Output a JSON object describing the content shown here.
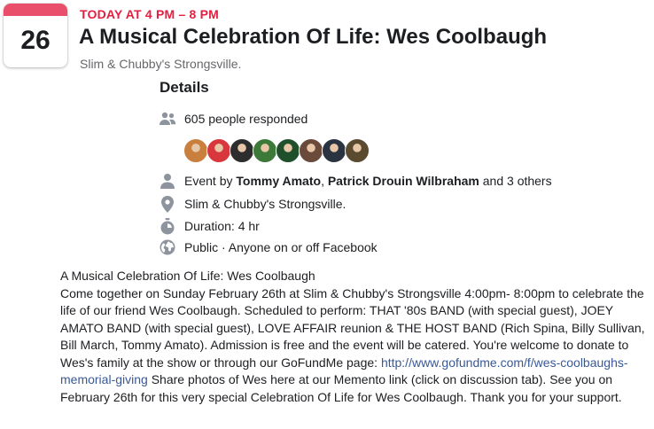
{
  "calendar": {
    "day": "26"
  },
  "event": {
    "time": "TODAY AT 4 PM – 8 PM",
    "title": "A Musical Celebration Of Life: Wes Coolbaugh",
    "venue": "Slim & Chubby's Strongsville."
  },
  "details": {
    "heading": "Details",
    "responded": "605 people responded",
    "hosts_prefix": "Event by ",
    "host1": "Tommy Amato",
    "host_sep": ", ",
    "host2": "Patrick Drouin Wilbraham",
    "hosts_suffix": " and 3 others",
    "location": "Slim & Chubby's Strongsville.",
    "duration": "Duration: 4 hr",
    "privacy": "Public · Anyone on or off Facebook"
  },
  "attendee_colors": [
    "#c9803f",
    "#d8373d",
    "#2d2d2d",
    "#3d7a3a",
    "#1f4f2b",
    "#6a4a3a",
    "#2a3340",
    "#5a4a30"
  ],
  "description": {
    "title_line": "A Musical Celebration Of Life: Wes Coolbaugh",
    "body_before_link": "Come together on Sunday February 26th at Slim & Chubby's Strongsville 4:00pm- 8:00pm to celebrate the life of our friend Wes Coolbaugh. Scheduled to perform: THAT '80s BAND (with special guest), JOEY AMATO BAND (with special guest), LOVE AFFAIR reunion & THE HOST BAND (Rich Spina, Billy Sullivan, Bill March, Tommy Amato). Admission is free and the event will be catered. You're welcome to donate to Wes's family at the show or through our GoFundMe page: ",
    "link": "http://www.gofundme.com/f/wes-coolbaughs-memorial-giving",
    "body_after_link": " Share photos of Wes here at our Memento link (click on discussion tab). See you on February 26th for this very special Celebration Of Life for Wes Coolbaugh. Thank you for your support."
  }
}
